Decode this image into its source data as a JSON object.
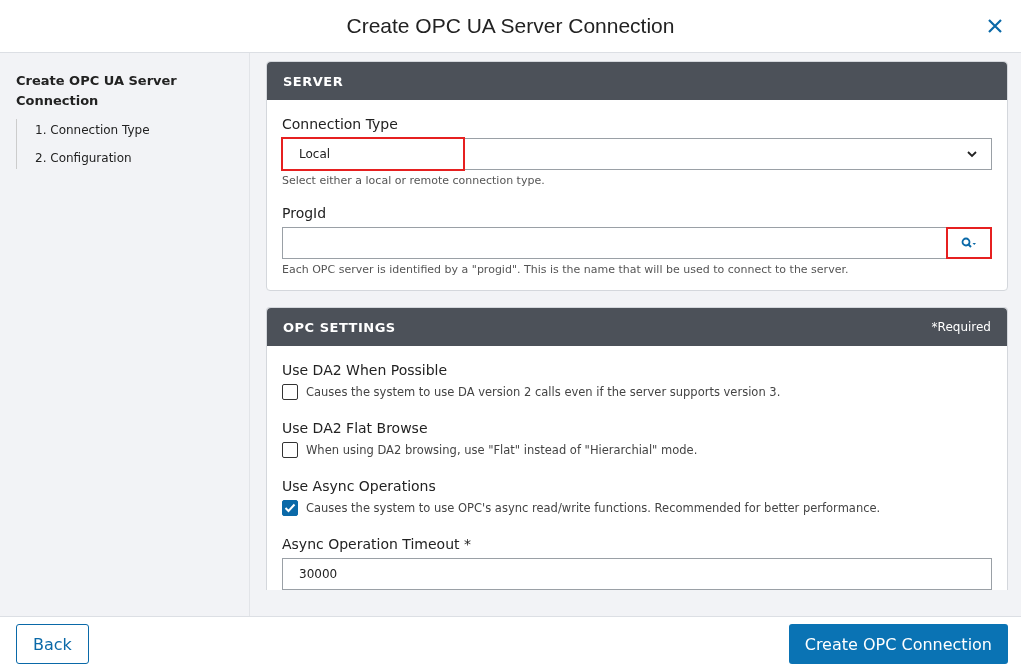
{
  "dialog": {
    "title": "Create OPC UA Server Connection"
  },
  "sidebar": {
    "title": "Create OPC UA Server Connection",
    "steps": [
      {
        "label": "1. Connection Type"
      },
      {
        "label": "2. Configuration"
      }
    ]
  },
  "server": {
    "heading": "SERVER",
    "connection_type": {
      "label": "Connection Type",
      "value": "Local",
      "highlighted": true,
      "help": "Select either a local or remote connection type."
    },
    "progid": {
      "label": "ProgId",
      "search_highlighted": true,
      "help": "Each OPC server is identified by a \"progid\". This is the name that will be used to connect to the server."
    }
  },
  "opc_settings": {
    "heading": "OPC SETTINGS",
    "required_note": "*Required",
    "options": [
      {
        "label": "Use DA2 When Possible",
        "description": "Causes the system to use DA version 2 calls even if the server supports version 3.",
        "checked": false
      },
      {
        "label": "Use DA2 Flat Browse",
        "description": "When using DA2 browsing, use \"Flat\" instead of \"Hierarchial\" mode.",
        "checked": false
      },
      {
        "label": "Use Async Operations",
        "description": "Causes the system to use OPC's async read/write functions. Recommended for better performance.",
        "checked": true
      }
    ],
    "timeout": {
      "label": "Async Operation Timeout *",
      "value": "30000"
    }
  },
  "footer": {
    "back": "Back",
    "create": "Create OPC Connection"
  }
}
